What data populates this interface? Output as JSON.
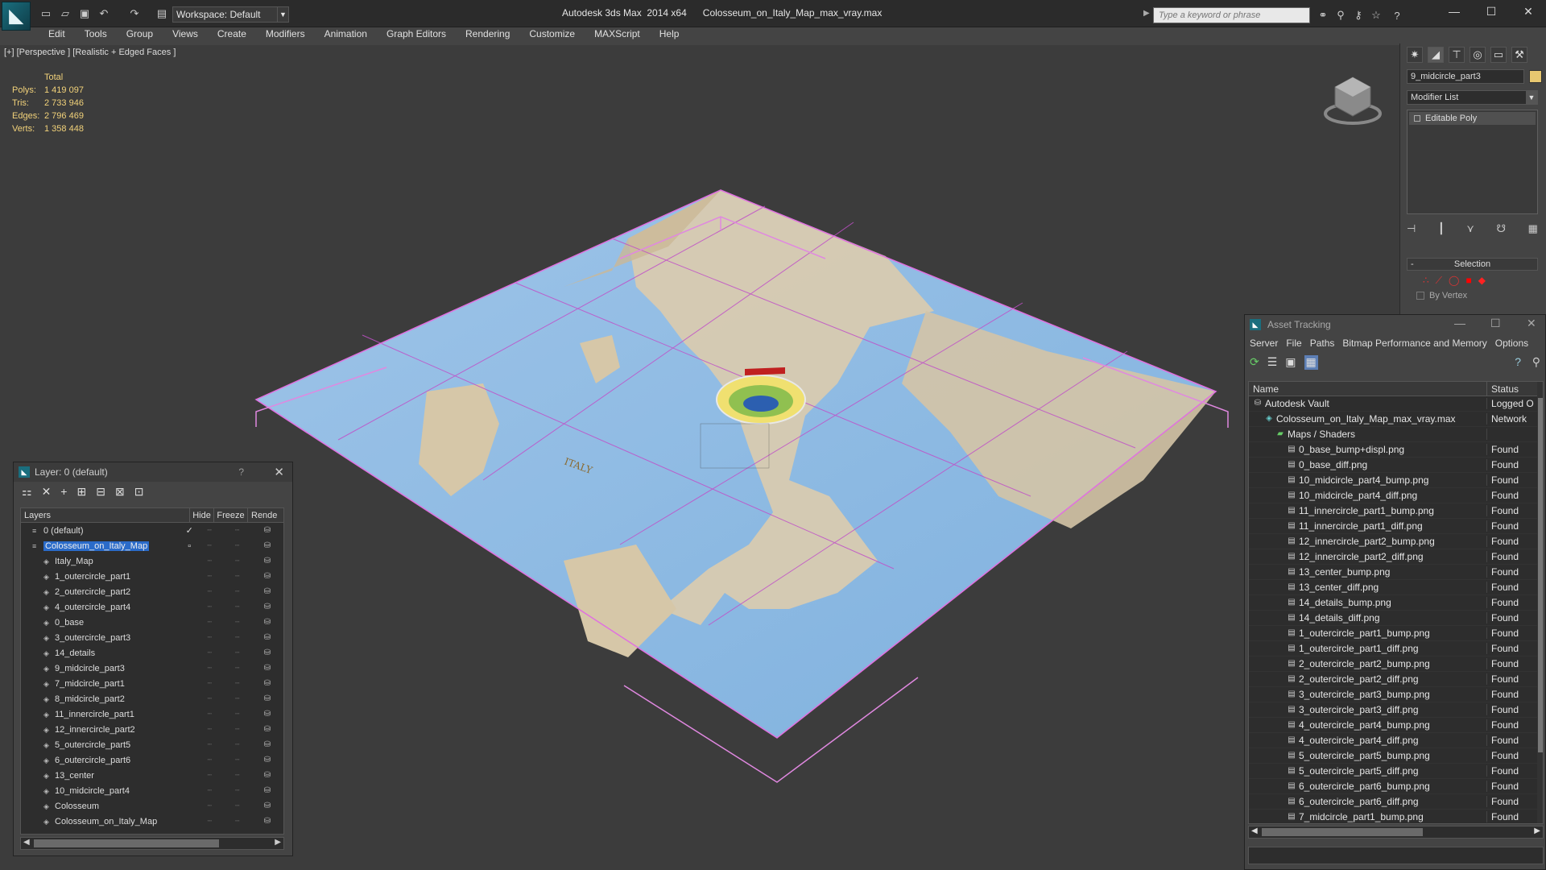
{
  "app": {
    "title": "Autodesk 3ds Max  2014 x64",
    "filename": "Colosseum_on_Italy_Map_max_vray.max",
    "workspace": "Workspace: Default",
    "search_placeholder": "Type a keyword or phrase"
  },
  "menu": [
    "Edit",
    "Tools",
    "Group",
    "Views",
    "Create",
    "Modifiers",
    "Animation",
    "Graph Editors",
    "Rendering",
    "Customize",
    "MAXScript",
    "Help"
  ],
  "viewport": {
    "label": "[+] [Perspective ] [Realistic + Edged Faces ]",
    "stats": {
      "header": "Total",
      "rows": [
        {
          "k": "Polys:",
          "v": "1 419 097"
        },
        {
          "k": "Tris:",
          "v": "2 733 946"
        },
        {
          "k": "Edges:",
          "v": "2 796 469"
        },
        {
          "k": "Verts:",
          "v": "1 358 448"
        }
      ]
    }
  },
  "command_panel": {
    "object_name": "9_midcircle_part3",
    "object_color": "#e8c870",
    "modifier_list": "Modifier List",
    "stack_item": "Editable Poly",
    "selection_title": "Selection",
    "by_vertex": "By Vertex"
  },
  "layer_explorer": {
    "title": "Layer: 0 (default)",
    "help": "?",
    "columns": {
      "layers": "Layers",
      "hide": "Hide",
      "freeze": "Freeze",
      "render": "Rende"
    },
    "rows": [
      {
        "name": "0 (default)",
        "indent": 1,
        "kind": "layer",
        "selected": false,
        "current": true
      },
      {
        "name": "Colosseum_on_Italy_Map",
        "indent": 1,
        "kind": "layer",
        "selected": true,
        "current": false
      },
      {
        "name": "Italy_Map",
        "indent": 2,
        "kind": "obj",
        "selected": false,
        "current": false
      },
      {
        "name": "1_outercircle_part1",
        "indent": 2,
        "kind": "obj",
        "selected": false,
        "current": false
      },
      {
        "name": "2_outercircle_part2",
        "indent": 2,
        "kind": "obj",
        "selected": false,
        "current": false
      },
      {
        "name": "4_outercircle_part4",
        "indent": 2,
        "kind": "obj",
        "selected": false,
        "current": false
      },
      {
        "name": "0_base",
        "indent": 2,
        "kind": "obj",
        "selected": false,
        "current": false
      },
      {
        "name": "3_outercircle_part3",
        "indent": 2,
        "kind": "obj",
        "selected": false,
        "current": false
      },
      {
        "name": "14_details",
        "indent": 2,
        "kind": "obj",
        "selected": false,
        "current": false
      },
      {
        "name": "9_midcircle_part3",
        "indent": 2,
        "kind": "obj",
        "selected": false,
        "current": false
      },
      {
        "name": "7_midcircle_part1",
        "indent": 2,
        "kind": "obj",
        "selected": false,
        "current": false
      },
      {
        "name": "8_midcircle_part2",
        "indent": 2,
        "kind": "obj",
        "selected": false,
        "current": false
      },
      {
        "name": "11_innercircle_part1",
        "indent": 2,
        "kind": "obj",
        "selected": false,
        "current": false
      },
      {
        "name": "12_innercircle_part2",
        "indent": 2,
        "kind": "obj",
        "selected": false,
        "current": false
      },
      {
        "name": "5_outercircle_part5",
        "indent": 2,
        "kind": "obj",
        "selected": false,
        "current": false
      },
      {
        "name": "6_outercircle_part6",
        "indent": 2,
        "kind": "obj",
        "selected": false,
        "current": false
      },
      {
        "name": "13_center",
        "indent": 2,
        "kind": "obj",
        "selected": false,
        "current": false
      },
      {
        "name": "10_midcircle_part4",
        "indent": 2,
        "kind": "obj",
        "selected": false,
        "current": false
      },
      {
        "name": "Colosseum",
        "indent": 2,
        "kind": "obj",
        "selected": false,
        "current": false
      },
      {
        "name": "Colosseum_on_Italy_Map",
        "indent": 2,
        "kind": "obj",
        "selected": false,
        "current": false
      }
    ]
  },
  "asset_tracking": {
    "title": "Asset Tracking",
    "menu": [
      "Server",
      "File",
      "Paths",
      "Bitmap Performance and Memory",
      "Options"
    ],
    "columns": {
      "name": "Name",
      "status": "Status"
    },
    "rows": [
      {
        "name": "Autodesk Vault",
        "status": "Logged O",
        "indent": 1,
        "icon": "vault"
      },
      {
        "name": "Colosseum_on_Italy_Map_max_vray.max",
        "status": "Network",
        "indent": 2,
        "icon": "max"
      },
      {
        "name": "Maps / Shaders",
        "status": "",
        "indent": 3,
        "icon": "folder"
      },
      {
        "name": "0_base_bump+displ.png",
        "status": "Found",
        "indent": 4,
        "icon": "file"
      },
      {
        "name": "0_base_diff.png",
        "status": "Found",
        "indent": 4,
        "icon": "file"
      },
      {
        "name": "10_midcircle_part4_bump.png",
        "status": "Found",
        "indent": 4,
        "icon": "file"
      },
      {
        "name": "10_midcircle_part4_diff.png",
        "status": "Found",
        "indent": 4,
        "icon": "file"
      },
      {
        "name": "11_innercircle_part1_bump.png",
        "status": "Found",
        "indent": 4,
        "icon": "file"
      },
      {
        "name": "11_innercircle_part1_diff.png",
        "status": "Found",
        "indent": 4,
        "icon": "file"
      },
      {
        "name": "12_innercircle_part2_bump.png",
        "status": "Found",
        "indent": 4,
        "icon": "file"
      },
      {
        "name": "12_innercircle_part2_diff.png",
        "status": "Found",
        "indent": 4,
        "icon": "file"
      },
      {
        "name": "13_center_bump.png",
        "status": "Found",
        "indent": 4,
        "icon": "file"
      },
      {
        "name": "13_center_diff.png",
        "status": "Found",
        "indent": 4,
        "icon": "file"
      },
      {
        "name": "14_details_bump.png",
        "status": "Found",
        "indent": 4,
        "icon": "file"
      },
      {
        "name": "14_details_diff.png",
        "status": "Found",
        "indent": 4,
        "icon": "file"
      },
      {
        "name": "1_outercircle_part1_bump.png",
        "status": "Found",
        "indent": 4,
        "icon": "file"
      },
      {
        "name": "1_outercircle_part1_diff.png",
        "status": "Found",
        "indent": 4,
        "icon": "file"
      },
      {
        "name": "2_outercircle_part2_bump.png",
        "status": "Found",
        "indent": 4,
        "icon": "file"
      },
      {
        "name": "2_outercircle_part2_diff.png",
        "status": "Found",
        "indent": 4,
        "icon": "file"
      },
      {
        "name": "3_outercircle_part3_bump.png",
        "status": "Found",
        "indent": 4,
        "icon": "file"
      },
      {
        "name": "3_outercircle_part3_diff.png",
        "status": "Found",
        "indent": 4,
        "icon": "file"
      },
      {
        "name": "4_outercircle_part4_bump.png",
        "status": "Found",
        "indent": 4,
        "icon": "file"
      },
      {
        "name": "4_outercircle_part4_diff.png",
        "status": "Found",
        "indent": 4,
        "icon": "file"
      },
      {
        "name": "5_outercircle_part5_bump.png",
        "status": "Found",
        "indent": 4,
        "icon": "file"
      },
      {
        "name": "5_outercircle_part5_diff.png",
        "status": "Found",
        "indent": 4,
        "icon": "file"
      },
      {
        "name": "6_outercircle_part6_bump.png",
        "status": "Found",
        "indent": 4,
        "icon": "file"
      },
      {
        "name": "6_outercircle_part6_diff.png",
        "status": "Found",
        "indent": 4,
        "icon": "file"
      },
      {
        "name": "7_midcircle_part1_bump.png",
        "status": "Found",
        "indent": 4,
        "icon": "file"
      }
    ]
  }
}
